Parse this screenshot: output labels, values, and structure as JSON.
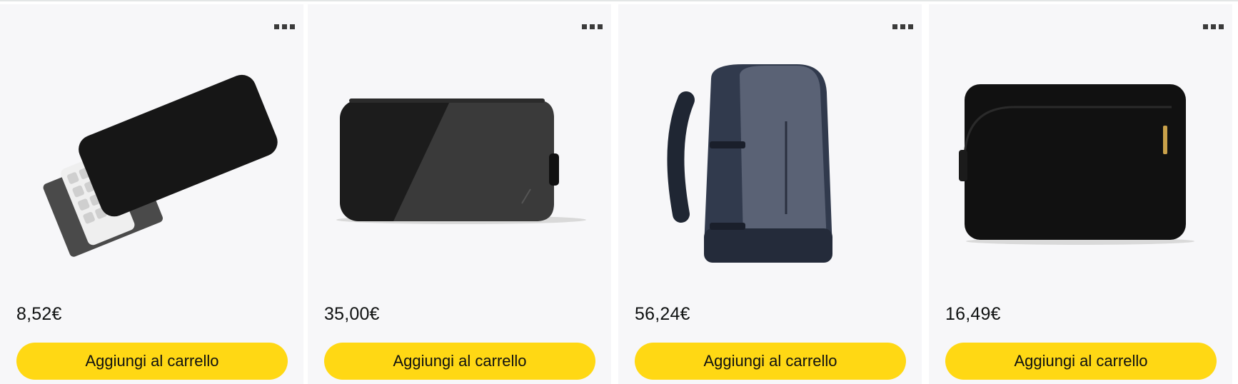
{
  "products": [
    {
      "price": "8,52€",
      "cta": "Aggiungi al carrello",
      "icon": "keyboard-sleeve-image"
    },
    {
      "price": "35,00€",
      "cta": "Aggiungi al carrello",
      "icon": "tech-organizer-pouch-image"
    },
    {
      "price": "56,24€",
      "cta": "Aggiungi al carrello",
      "icon": "travel-backpack-image"
    },
    {
      "price": "16,49€",
      "cta": "Aggiungi al carrello",
      "icon": "laptop-sleeve-image"
    }
  ],
  "colors": {
    "button": "#ffd814",
    "card_bg": "#f7f7f9",
    "text": "#0f1111"
  },
  "more_menu_icon": "ellipsis-icon"
}
